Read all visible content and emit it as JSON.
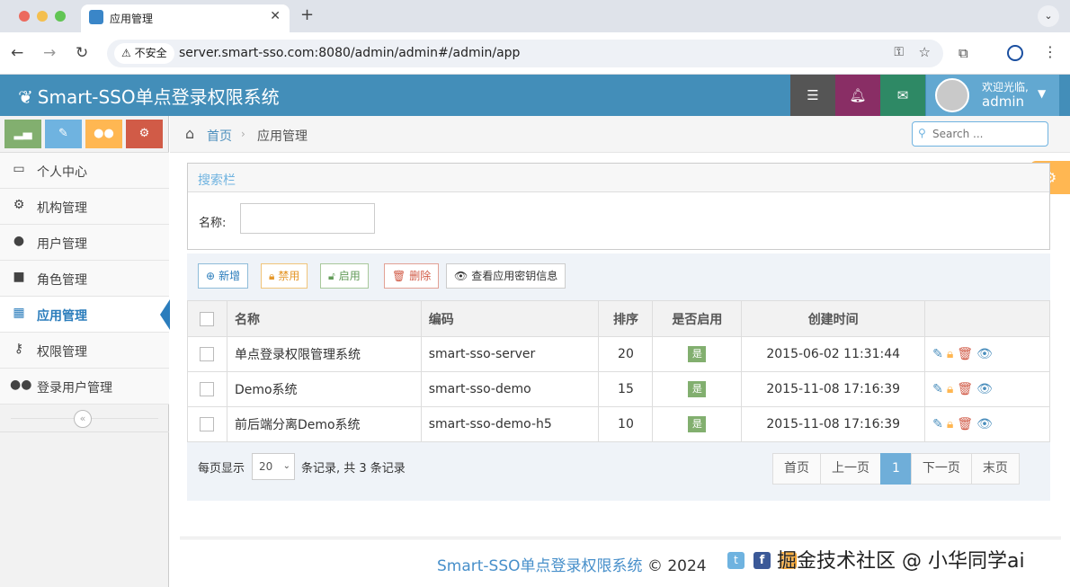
{
  "browser": {
    "tab_title": "应用管理",
    "tab_close": "✕",
    "new_tab": "+",
    "insecure_label": "不安全",
    "url": "server.smart-sso.com:8080/admin/admin#/admin/app"
  },
  "header": {
    "brand": "Smart-SSO单点登录权限系统",
    "welcome": "欢迎光临,",
    "username": "admin",
    "colors": {
      "bar": "#438eb9",
      "tasks": "#555555",
      "notice": "#892e65",
      "mail": "#2e8965",
      "user": "#62a8d1"
    }
  },
  "sidebar": {
    "shortcut_icons": [
      "signal-icon",
      "pencil-icon",
      "group-icon",
      "cogs-icon"
    ],
    "items": [
      {
        "label": "个人中心",
        "icon": "desktop-icon"
      },
      {
        "label": "机构管理",
        "icon": "cogs-icon"
      },
      {
        "label": "用户管理",
        "icon": "user-icon"
      },
      {
        "label": "角色管理",
        "icon": "briefcase-icon"
      },
      {
        "label": "应用管理",
        "icon": "th-large-icon",
        "active": true
      },
      {
        "label": "权限管理",
        "icon": "key-icon"
      },
      {
        "label": "登录用户管理",
        "icon": "users-icon"
      }
    ]
  },
  "breadcrumb": {
    "home": "首页",
    "current": "应用管理",
    "search_placeholder": "Search ..."
  },
  "search_panel": {
    "title": "搜索栏",
    "name_label": "名称:"
  },
  "toolbar": {
    "add": "新增",
    "disable": "禁用",
    "enable": "启用",
    "delete": "删除",
    "view_secret": "查看应用密钥信息"
  },
  "table": {
    "headers": [
      "名称",
      "编码",
      "排序",
      "是否启用",
      "创建时间"
    ],
    "rows": [
      {
        "name": "单点登录权限管理系统",
        "code": "smart-sso-server",
        "sort": "20",
        "enabled": "是",
        "created": "2015-06-02 11:31:44"
      },
      {
        "name": "Demo系统",
        "code": "smart-sso-demo",
        "sort": "15",
        "enabled": "是",
        "created": "2015-11-08 17:16:39"
      },
      {
        "name": "前后端分离Demo系统",
        "code": "smart-sso-demo-h5",
        "sort": "10",
        "enabled": "是",
        "created": "2015-11-08 17:16:39"
      }
    ]
  },
  "pager": {
    "per_page_label": "每页显示",
    "page_size": "20",
    "summary": "条记录, 共 3 条记录",
    "first": "首页",
    "prev": "上一页",
    "current": "1",
    "next": "下一页",
    "last": "末页"
  },
  "footer": {
    "brand": "Smart-SSO单点登录权限系统",
    "copyright": "© 2024",
    "watermark": "掘金技术社区 @ 小华同学ai"
  }
}
